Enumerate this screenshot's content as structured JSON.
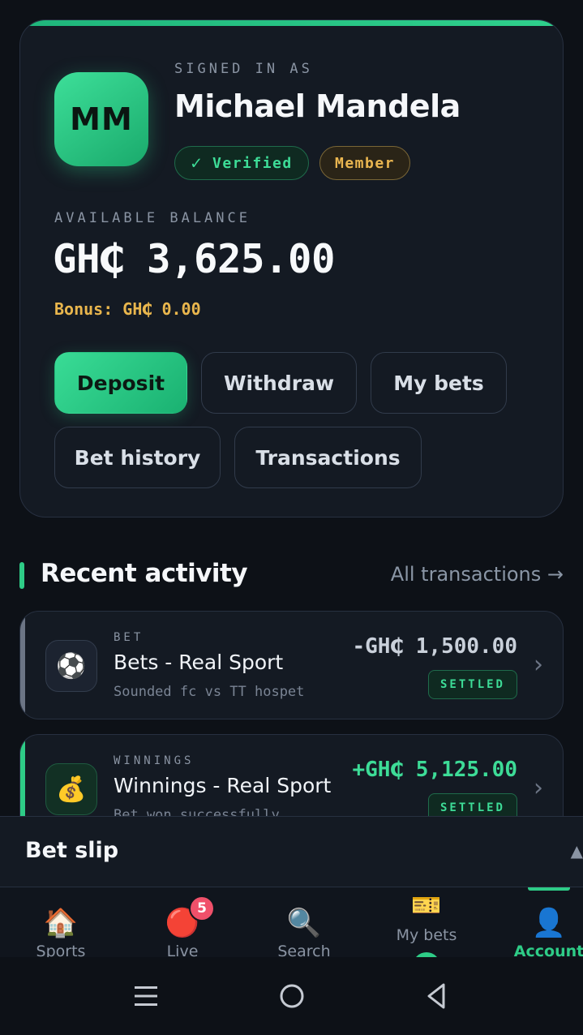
{
  "profile": {
    "signed_in_label": "SIGNED IN AS",
    "avatar_initials": "MM",
    "name": "Michael Mandela",
    "badges": {
      "verified_check": "✓",
      "verified": "Verified",
      "member": "Member"
    },
    "balance_label": "AVAILABLE BALANCE",
    "balance": "GH₵ 3,625.00",
    "bonus": "Bonus: GH₵ 0.00",
    "actions": {
      "deposit": "Deposit",
      "withdraw": "Withdraw",
      "my_bets": "My bets",
      "bet_history": "Bet history",
      "transactions": "Transactions"
    },
    "colors": {
      "accent": "#2ecc87",
      "gold": "#e9b64d"
    }
  },
  "activity": {
    "title": "Recent activity",
    "link": "All transactions →",
    "items": [
      {
        "icon": "⚽",
        "icon_name": "soccer-ball-icon",
        "type": "BET",
        "title": "Bets - Real Sport",
        "subtitle": "Sounded fc vs TT hospet",
        "amount": "-GH₵ 1,500.00",
        "status": "SETTLED"
      },
      {
        "icon": "💰",
        "icon_name": "money-bag-icon",
        "type": "WINNINGS",
        "title": "Winnings - Real Sport",
        "subtitle": "Bet won successfully",
        "amount": "+GH₵ 5,125.00",
        "status": "SETTLED"
      }
    ],
    "chevron": "›"
  },
  "bet_slip": {
    "label": "Bet slip",
    "toggle": "▲"
  },
  "nav": {
    "sports": {
      "icon": "🏠",
      "label": "Sports"
    },
    "live": {
      "icon": "🔴",
      "label": "Live",
      "badge": "5"
    },
    "search": {
      "icon": "🔍",
      "label": "Search"
    },
    "my_bets": {
      "icon": "🎫",
      "label": "My bets"
    },
    "account": {
      "icon": "👤",
      "label": "Account"
    }
  }
}
